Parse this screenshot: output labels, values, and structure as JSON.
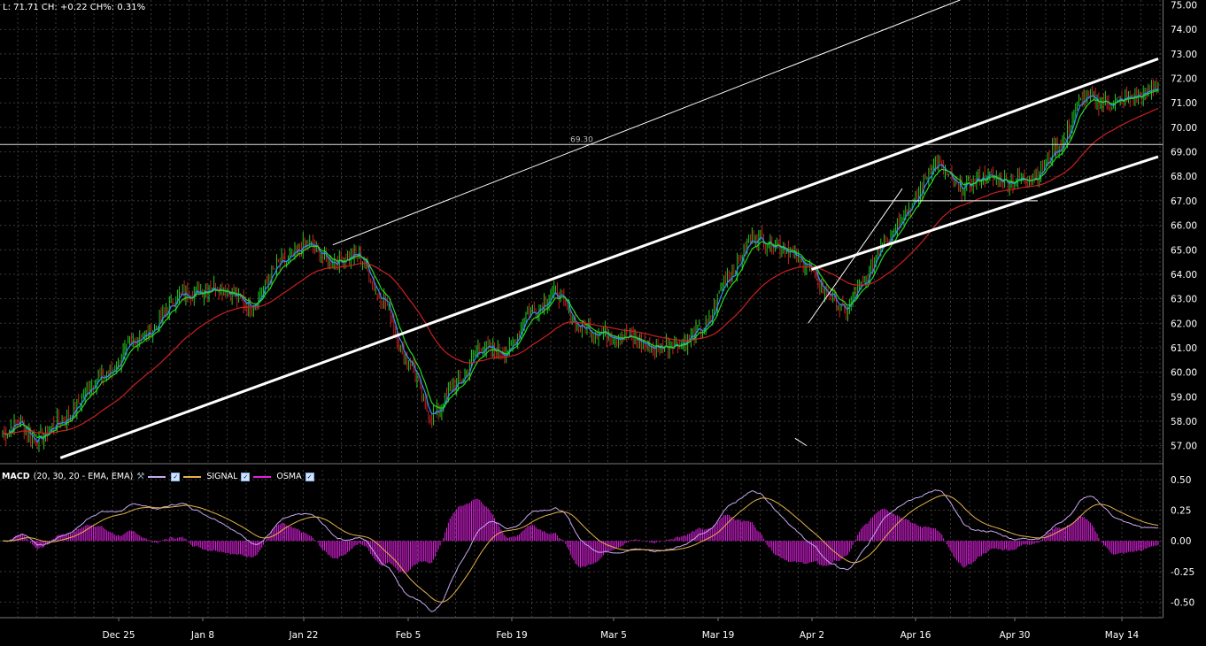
{
  "header": {
    "readout": "L: 71.71 CH: +0.22 CH%: 0.31%"
  },
  "hline_label": "69.30",
  "macd_legend": {
    "name": "MACD",
    "params": "(20, 30, 20 - EMA, EMA)",
    "items": [
      {
        "label": "",
        "color": "#c8a8f0"
      },
      {
        "label": "SIGNAL",
        "color": "#e6b24a"
      },
      {
        "label": "OSMA",
        "color": "#e020e0"
      }
    ]
  },
  "colors": {
    "background": "#000000",
    "grid": "#3a3a3a",
    "candle_up": "#22cc22",
    "candle_down": "#cc2222",
    "ma_fast": "#2f8fff",
    "ma_mid": "#22dd22",
    "ma_slow": "#cc2020",
    "trendline": "#ffffff",
    "macd": "#c8a8f0",
    "signal": "#e6b24a",
    "osma": "#e020e0"
  },
  "chart_data": [
    {
      "type": "line",
      "panel": "price",
      "y_ticks": [
        "75.00",
        "74.00",
        "73.00",
        "72.00",
        "71.00",
        "70.00",
        "69.00",
        "68.00",
        "67.00",
        "66.00",
        "65.00",
        "64.00",
        "63.00",
        "62.00",
        "61.00",
        "60.00",
        "59.00",
        "58.00",
        "57.00"
      ],
      "x_ticks": [
        "Dec 25",
        "Jan 8",
        "Jan 22",
        "Feb 5",
        "Feb 19",
        "Mar 5",
        "Mar 19",
        "Apr 2",
        "Apr 16",
        "Apr 30",
        "May 14"
      ],
      "ylim": [
        56.3,
        75.2
      ],
      "last": 71.71,
      "hline": 69.3,
      "anchors_close": [
        [
          0,
          57.5
        ],
        [
          10,
          58
        ],
        [
          20,
          57.2
        ],
        [
          35,
          58
        ],
        [
          60,
          59.8
        ],
        [
          85,
          61.5
        ],
        [
          110,
          63.2
        ],
        [
          130,
          63.5
        ],
        [
          150,
          62.8
        ],
        [
          170,
          64.5
        ],
        [
          185,
          65.2
        ],
        [
          200,
          64.5
        ],
        [
          215,
          64.8
        ],
        [
          230,
          63
        ],
        [
          245,
          60.5
        ],
        [
          260,
          58.2
        ],
        [
          275,
          59.5
        ],
        [
          290,
          61
        ],
        [
          305,
          60.8
        ],
        [
          320,
          62.5
        ],
        [
          335,
          63.2
        ],
        [
          350,
          61.8
        ],
        [
          365,
          61.6
        ],
        [
          380,
          61.4
        ],
        [
          395,
          61
        ],
        [
          410,
          61.2
        ],
        [
          425,
          61.8
        ],
        [
          440,
          64
        ],
        [
          455,
          65.5
        ],
        [
          470,
          65.2
        ],
        [
          485,
          64.5
        ],
        [
          500,
          63.2
        ],
        [
          510,
          62.5
        ],
        [
          520,
          63.5
        ],
        [
          535,
          65.5
        ],
        [
          550,
          66.8
        ],
        [
          565,
          68.5
        ],
        [
          580,
          67.5
        ],
        [
          595,
          68
        ],
        [
          610,
          67.8
        ],
        [
          625,
          68
        ],
        [
          640,
          69.2
        ],
        [
          655,
          71.2
        ],
        [
          670,
          71
        ],
        [
          690,
          71.3
        ],
        [
          700,
          71.7
        ]
      ],
      "moving_averages": [
        {
          "period": 5,
          "color": "#2f8fff"
        },
        {
          "period": 10,
          "color": "#22dd22"
        },
        {
          "period": 60,
          "color": "#cc2020"
        }
      ],
      "trendlines": [
        {
          "x1": 35,
          "y1": 56.5,
          "x2": 700,
          "y2": 72.8,
          "width": 3
        },
        {
          "x1": 200,
          "y1": 65.2,
          "x2": 580,
          "y2": 75.2,
          "width": 1
        },
        {
          "x1": 490,
          "y1": 64.2,
          "x2": 700,
          "y2": 68.8,
          "width": 3
        },
        {
          "x1": 488,
          "y1": 62,
          "x2": 545,
          "y2": 67.5,
          "width": 1
        },
        {
          "x1": 525,
          "y1": 67,
          "x2": 627,
          "y2": 67,
          "width": 1
        },
        {
          "x1": 480,
          "y1": 57.3,
          "x2": 487,
          "y2": 57.0,
          "width": 1
        }
      ]
    },
    {
      "type": "line",
      "panel": "macd",
      "y_ticks": [
        "0.50",
        "0.25",
        "0.00",
        "-0.25",
        "-0.50"
      ],
      "ylim": [
        -0.62,
        0.58
      ],
      "series_names": [
        "SIGNAL",
        "OSMA"
      ]
    }
  ]
}
